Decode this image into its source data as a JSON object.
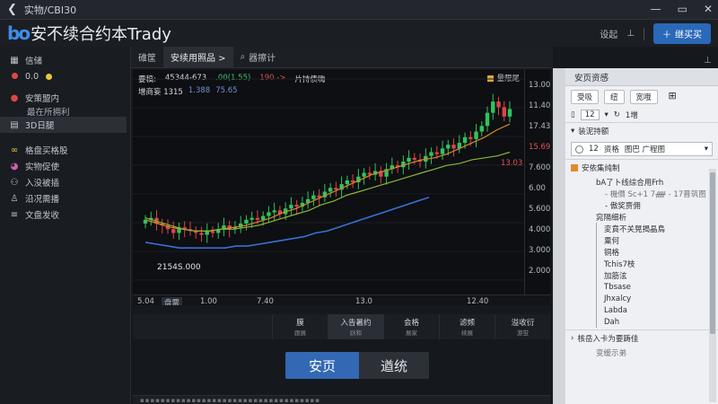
{
  "window": {
    "title": "实物/CBI30",
    "controls": [
      "—",
      "▭",
      "✕"
    ]
  },
  "header": {
    "logo": "bo",
    "app_name": "安不续合约本Trady",
    "link": "设起",
    "primary_button": "继买买"
  },
  "sidebar": {
    "items": [
      {
        "label": "信储",
        "icon": "grid-icon"
      },
      {
        "label": "0.0",
        "icon": "status-dots-icon"
      },
      {
        "label": "安策盟内",
        "icon": "user-icon",
        "sub": "最在所拥利"
      },
      {
        "label": "3D日腿",
        "icon": "doc-icon",
        "active": true
      },
      {
        "label": "格盘买格股",
        "icon": "link-icon"
      },
      {
        "label": "实物促使",
        "icon": "palette-icon"
      },
      {
        "label": "入没被插",
        "icon": "people-icon"
      },
      {
        "label": "沿况需播",
        "icon": "person-icon"
      },
      {
        "label": "文盘发收",
        "icon": "list-icon"
      }
    ]
  },
  "tabs": [
    {
      "label": "碓筐"
    },
    {
      "label": "安续用照品 >",
      "active": true
    },
    {
      "label": "器擦计"
    }
  ],
  "chart_legend": {
    "row1": {
      "label": "要稿:",
      "v1": "45344-673",
      "v2": ".00(1.55)",
      "v3": "190 ->",
      "v4": "片持债嗨"
    },
    "row2": {
      "label": "增商妄 1315",
      "v1": "1.388",
      "v2": "75.65"
    },
    "indicator": "量限尾"
  },
  "chart_data": {
    "type": "candlestick",
    "title": "",
    "x_ticks": [
      "5.04",
      "盘票",
      "1.00",
      "7.40",
      "13.0",
      "12.40"
    ],
    "y_ticks": [
      "13.00",
      "11.40",
      "17.43",
      "15.69",
      "7.600",
      "6.00",
      "5.600",
      "4.000",
      "3.000",
      "2.000"
    ],
    "cursor_price": "13.03",
    "last_price_label": "2154S.000",
    "series": [
      {
        "name": "price",
        "type": "candles",
        "open": [
          5.3,
          5.5,
          5.6,
          5.3,
          5.2,
          5.0,
          4.8,
          5.1,
          5.0,
          4.9,
          4.8,
          4.7,
          4.9,
          4.8,
          5.0,
          5.2,
          5.0,
          5.1,
          5.3,
          5.5,
          5.6,
          5.5,
          5.7,
          5.9,
          6.0,
          5.8,
          6.1,
          6.3,
          6.2,
          6.4,
          6.6,
          6.8,
          6.7,
          7.0,
          7.2,
          7.1,
          7.4,
          7.6,
          7.5,
          7.8,
          8.0,
          7.9,
          8.1,
          7.8,
          8.2,
          8.4,
          8.3,
          8.6,
          8.8,
          8.7,
          8.6,
          8.9,
          9.1,
          9.0,
          9.3,
          9.5,
          9.3,
          9.6,
          9.9,
          9.8,
          10.2,
          10.5,
          11.2,
          11.8,
          11.5,
          11.0
        ],
        "close": [
          5.5,
          5.6,
          5.3,
          5.2,
          5.0,
          4.8,
          5.1,
          5.0,
          4.9,
          4.8,
          4.7,
          4.9,
          4.8,
          5.0,
          5.2,
          5.0,
          5.1,
          5.3,
          5.5,
          5.6,
          5.5,
          5.7,
          5.9,
          6.0,
          5.8,
          6.1,
          6.3,
          6.2,
          6.4,
          6.6,
          6.8,
          6.7,
          7.0,
          7.2,
          7.1,
          7.4,
          7.6,
          7.5,
          7.8,
          8.0,
          7.9,
          8.1,
          7.8,
          8.2,
          8.4,
          8.3,
          8.6,
          8.8,
          8.7,
          8.6,
          8.9,
          9.1,
          9.0,
          9.3,
          9.5,
          9.3,
          9.6,
          9.9,
          9.8,
          10.2,
          10.5,
          11.2,
          11.8,
          11.5,
          11.0,
          11.4
        ]
      },
      {
        "name": "ma_blue",
        "type": "line",
        "values": [
          4.3,
          4.2,
          4.1,
          4.0,
          4.0,
          4.0,
          4.0,
          4.0,
          4.1,
          4.1,
          4.2,
          4.3,
          4.4,
          4.5,
          4.6,
          4.8,
          4.9,
          5.1,
          5.3,
          5.5,
          5.7,
          5.9,
          6.1,
          6.3,
          6.5,
          6.7
        ]
      },
      {
        "name": "ma_orange",
        "type": "line",
        "values": [
          5.5,
          5.3,
          5.1,
          5.0,
          4.9,
          4.9,
          5.0,
          5.1,
          5.2,
          5.4,
          5.6,
          5.9,
          6.1,
          6.4,
          6.7,
          7.0,
          7.3,
          7.6,
          7.9,
          8.1,
          8.3,
          8.5,
          8.7,
          8.8,
          9.0,
          9.3,
          9.6,
          9.9,
          10.3,
          10.6
        ]
      },
      {
        "name": "ma_green",
        "type": "line",
        "values": [
          5.6,
          5.4,
          5.2,
          5.0,
          4.9,
          4.9,
          5.0,
          5.0,
          5.1,
          5.2,
          5.4,
          5.6,
          5.8,
          6.0,
          6.3,
          6.5,
          6.8,
          7.0,
          7.2,
          7.4,
          7.6,
          7.8,
          8.0,
          8.2,
          8.4,
          8.5,
          8.7,
          8.8,
          8.9,
          9.1
        ]
      }
    ]
  },
  "actions": [
    {
      "label": "膜",
      "sub": "跟展"
    },
    {
      "label": "入告暑约",
      "sub": "跃和",
      "selected": true
    },
    {
      "label": "会格",
      "sub": "展家"
    },
    {
      "label": "滤频",
      "sub": "续展"
    },
    {
      "label": "溢收衍",
      "sub": "游蛍"
    }
  ],
  "cta": {
    "primary": "安页",
    "secondary": "遒统"
  },
  "right_panel": {
    "title": "安页资感",
    "buttons": [
      "受吸",
      "纽",
      "宽哦"
    ],
    "tools": {
      "b1": "12",
      "b2": "1增"
    },
    "section1": "装泥持额",
    "select": {
      "v1": "12",
      "v2": "资格",
      "v3": "图巴 广程图"
    },
    "section2": "安依集纯制",
    "items": [
      {
        "label": "bA了卜线综合用Frh",
        "level": 1
      },
      {
        "label": "- 機價 Sc+1 7ᚏ - 17晋筑图",
        "level": 2,
        "muted": true
      },
      {
        "label": "- 傲奖贾佣",
        "level": 2
      },
      {
        "label": "窕隔细析",
        "level": 1
      },
      {
        "label": "変賁不关晃揭晶鳥",
        "level": 3
      },
      {
        "label": "粟何",
        "level": 3
      },
      {
        "label": "铜格",
        "level": 3
      },
      {
        "label": "Tchis7枝",
        "level": 3
      },
      {
        "label": "加筋泫",
        "level": 3
      },
      {
        "label": "Tbsase",
        "level": 3
      },
      {
        "label": "Jhxalcy",
        "level": 3
      },
      {
        "label": "Labda",
        "level": 3
      },
      {
        "label": "Dah",
        "level": 3
      }
    ],
    "footer_items": [
      "核岳入卡为要踌佳",
      "变缓示弟"
    ]
  }
}
